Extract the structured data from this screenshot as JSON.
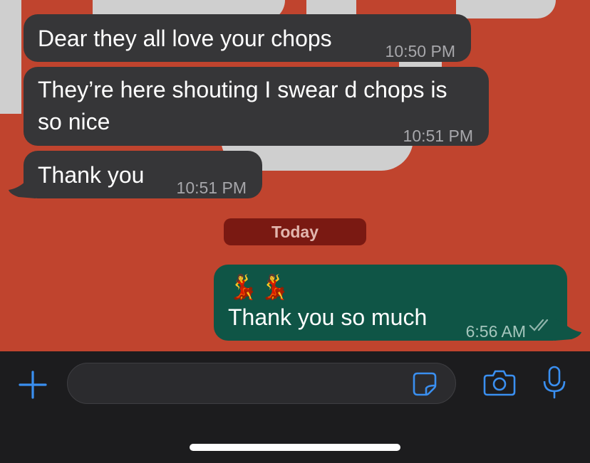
{
  "messages": {
    "incoming": [
      {
        "text": "Dear they all love your chops",
        "time": "10:50 PM"
      },
      {
        "text_line1": "They’re here shouting I swear d chops is",
        "text_line2": "so nice",
        "time": "10:51 PM"
      },
      {
        "text": "Thank you",
        "time": "10:51 PM"
      }
    ],
    "date_separator": "Today",
    "outgoing": {
      "emoji": "💃",
      "text": "Thank you so much",
      "time": "6:56 AM",
      "status": "read-double-check-icon"
    }
  },
  "composer": {
    "input_value": "",
    "icons": [
      "plus-icon",
      "sticker-icon",
      "camera-icon",
      "microphone-icon"
    ]
  },
  "colors": {
    "wallpaper": "#c0442e",
    "incoming_bubble": "#363638",
    "outgoing_bubble": "#0f5546",
    "date_pill": "#7a1912",
    "accent_blue": "#3a8ff0",
    "composer_bg": "#1c1c1e"
  }
}
